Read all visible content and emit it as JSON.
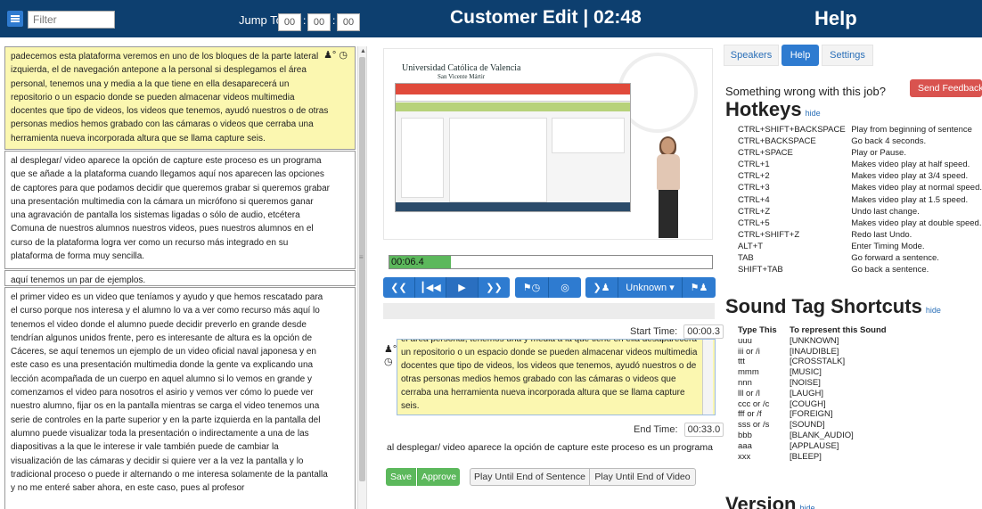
{
  "header": {
    "filter_placeholder": "Filter",
    "jump_label": "Jump To:",
    "jump_hours": "00",
    "jump_minutes": "00",
    "jump_seconds": "00",
    "title": "Customer Edit | 02:48",
    "help_title": "Help"
  },
  "transcript": {
    "segments": [
      {
        "text": "padecemos esta plataforma veremos en uno de los bloques de la parte lateral izquierda, el de navegación antepone a la personal si desplegamos el área personal, tenemos una y media a la que tiene en ella desaparecerá un repositorio o un espacio donde se pueden almacenar videos multimedia docentes que tipo de videos, los videos que tenemos, ayudó nuestros o de otras personas medios hemos grabado con las cámaras o videos que cerraba una herramienta nueva incorporada altura que se llama capture seis."
      },
      {
        "text": "al desplegar/ video aparece la opción de capture este proceso es un programa que se añade a la plataforma cuando llegamos aquí nos aparecen las opciones de captores para que podamos decidir que queremos grabar si queremos grabar una presentación multimedia con la cámara un micrófono si queremos ganar una agravación de pantalla los sistemas ligadas o sólo de audio, etcétera Comuna de nuestros alumnos nuestros videos, pues nuestros alumnos en el curso de la plataforma logra ver como un recurso más integrado en su plataforma de forma muy sencilla."
      },
      {
        "text": "aquí tenemos un par de ejemplos."
      },
      {
        "text": "el primer video es un video que teníamos y ayudo y que hemos rescatado para el curso porque nos interesa y el alumno lo va a ver como recurso más aquí lo tenemos el video donde el alumno puede decidir preverlo en grande desde tendrían algunos unidos frente, pero es interesante de altura es la opción de Cáceres, se aquí tenemos un ejemplo de un video oficial naval japonesa y en este caso es una presentación multimedia donde la gente va explicando una lección acompañada de un cuerpo en aquel alumno si lo vemos en grande y comenzamos el video para nosotros el asirio y vemos ver cómo lo puede ver nuestro alumno, fijar os en la pantalla mientras se carga el video tenemos una serie de controles en la parte superior y en la parte izquierda en la pantalla del alumno puede visualizar toda la presentación o indirectamente a una de las diapositivas a la que le interese ir vale también puede de cambiar la visualización de las cámaras y decidir si quiere ver a la vez la pantalla y lo tradicional proceso o puede ir alternando o me interesa solamente de la pantalla y no me enteré saber ahora, en este caso, pues al profesor"
      }
    ]
  },
  "video": {
    "logo_text": "Universidad Católica de Valencia",
    "logo_sub": "San Vicente Mártir"
  },
  "player": {
    "progress_time": "00:06.4",
    "progress_fraction": 0.19,
    "speaker_select": "Unknown",
    "start_label": "Start Time:",
    "start_time": "00:00.3",
    "end_label": "End Time:",
    "end_time": "00:33.0",
    "editor_text": "el área personal, tenemos una y media a la que tiene en ella desaparecerá un repositorio o un espacio donde se pueden almacenar videos multimedia docentes que tipo de videos, los videos que tenemos, ayudó nuestros o de otras personas medios hemos grabado con las cámaras o videos que cerraba una herramienta nueva incorporada altura que se llama capture seis.",
    "next_sentence": "al desplegar/ video aparece la opción de capture este proceso es un programa qu",
    "save_label": "Save",
    "approve_label": "Approve",
    "play_sentence_label": "Play Until End of Sentence",
    "play_video_label": "Play Until End of Video"
  },
  "help": {
    "tabs": [
      "Speakers",
      "Help",
      "Settings"
    ],
    "question": "Something wrong with this job?",
    "feedback_label": "Send Feedback",
    "hotkeys_title": "Hotkeys",
    "hide_label": "hide",
    "hotkeys": [
      {
        "key": "CTRL+SHIFT+BACKSPACE",
        "desc": "Play from beginning of sentence"
      },
      {
        "key": "CTRL+BACKSPACE",
        "desc": "Go back 4 seconds."
      },
      {
        "key": "CTRL+SPACE",
        "desc": "Play or Pause."
      },
      {
        "key": "CTRL+1",
        "desc": "Makes video play at half speed."
      },
      {
        "key": "CTRL+2",
        "desc": "Makes video play at 3/4 speed."
      },
      {
        "key": "CTRL+3",
        "desc": "Makes video play at normal speed."
      },
      {
        "key": "CTRL+4",
        "desc": "Makes video play at 1.5 speed."
      },
      {
        "key": "CTRL+Z",
        "desc": "Undo last change."
      },
      {
        "key": "CTRL+5",
        "desc": "Makes video play at double speed."
      },
      {
        "key": "CTRL+SHIFT+Z",
        "desc": "Redo last Undo."
      },
      {
        "key": "ALT+T",
        "desc": "Enter Timing Mode."
      },
      {
        "key": "TAB",
        "desc": "Go forward a sentence."
      },
      {
        "key": "SHIFT+TAB",
        "desc": "Go back a sentence."
      }
    ],
    "sound_title": "Sound Tag Shortcuts",
    "sound_headers": [
      "Type This",
      "To represent this Sound"
    ],
    "sound_tags": [
      {
        "type": "uuu",
        "tag": "[UNKNOWN]"
      },
      {
        "type": "iii or /i",
        "tag": "[INAUDIBLE]"
      },
      {
        "type": "ttt",
        "tag": "[CROSSTALK]"
      },
      {
        "type": "mmm",
        "tag": "[MUSIC]"
      },
      {
        "type": "nnn",
        "tag": "[NOISE]"
      },
      {
        "type": "lll or /l",
        "tag": "[LAUGH]"
      },
      {
        "type": "ccc or /c",
        "tag": "[COUGH]"
      },
      {
        "type": "fff or /f",
        "tag": "[FOREIGN]"
      },
      {
        "type": "sss or /s",
        "tag": "[SOUND]"
      },
      {
        "type": "bbb",
        "tag": "[BLANK_AUDIO]"
      },
      {
        "type": "aaa",
        "tag": "[APPLAUSE]"
      },
      {
        "type": "xxx",
        "tag": "[BLEEP]"
      }
    ],
    "version_title": "Version"
  },
  "colors": {
    "header_bg": "#0d3f6f",
    "accent_blue": "#2e7bd0",
    "success_green": "#5cb85c",
    "danger_red": "#d9534f",
    "active_segment": "#fbf7b0"
  },
  "icons": [
    "menu-icon",
    "speaker-icon",
    "clock-icon",
    "rewind-icon",
    "skip-back-icon",
    "play-icon",
    "forward-icon",
    "flag-clock-icon",
    "target-icon",
    "speaker-forward-icon",
    "flag-speaker-icon"
  ]
}
